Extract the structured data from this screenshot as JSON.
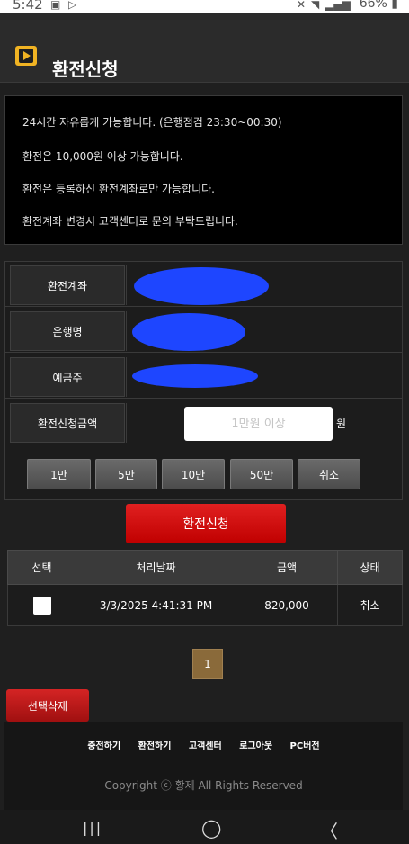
{
  "status_bar": {
    "time": "5:42",
    "battery": "66%",
    "icons": [
      "image-icon",
      "play-store-icon",
      "mute-icon",
      "wifi-icon",
      "signal-icon",
      "battery-icon"
    ]
  },
  "header": {
    "title": "환전신청",
    "icon": "play-icon",
    "accent_color": "#f0b323"
  },
  "notice": {
    "lines": [
      "24시간 자유롭게 가능합니다. (은행점검 23:30~00:30)",
      "환전은 10,000원 이상 가능합니다.",
      "환전은 등록하신 환전계좌로만 가능합니다.",
      "환전계좌 변경시 고객센터로 문의 부탁드립니다."
    ]
  },
  "form": {
    "account_label": "환전계좌",
    "bank_label": "은행명",
    "holder_label": "예금주",
    "amount_label": "환전신청금액",
    "amount_placeholder": "1만원 이상",
    "currency_unit": "원",
    "quick_buttons": [
      "1만",
      "5만",
      "10만",
      "50만",
      "취소"
    ],
    "submit_label": "환전신청",
    "submit_color": "#d41818"
  },
  "history": {
    "columns": [
      "선택",
      "처리날짜",
      "금액",
      "상태"
    ],
    "rows": [
      {
        "date": "3/3/2025 4:41:31 PM",
        "amount": "820,000",
        "status": "취소"
      }
    ]
  },
  "pagination": {
    "current_page": "1"
  },
  "delete_button": "선택삭제",
  "footer": {
    "links": [
      "충전하기",
      "환전하기",
      "고객센터",
      "로그아웃",
      "PC버전"
    ],
    "copyright": "Copyright ⓒ 황제 All Rights Reserved"
  },
  "nav": {
    "recent": "|||",
    "home": "◯",
    "back": "〈"
  }
}
